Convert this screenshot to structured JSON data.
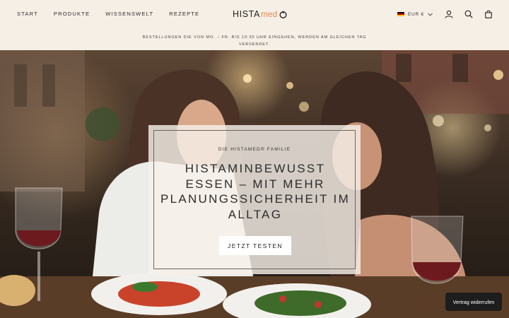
{
  "header": {
    "nav": [
      "START",
      "PRODUKTE",
      "WISSENSWELT",
      "REZEPTE"
    ],
    "logo_main": "HISTA",
    "logo_sub": "med",
    "currency": "EUR €"
  },
  "announcement": {
    "line1": "BESTELLUNGEN DIE VON MO. – FR. BIS 10:30 UHR EINGEHEN, WERDEN AM GLEICHEN TAG",
    "line2": "VERSENDET."
  },
  "hero": {
    "eyebrow": "DIE HISTAMED® FAMILIE",
    "headline": "HISTAMINBEWUSST ESSEN – MIT MEHR PLANUNGSSICHERHEIT IM ALLTAG",
    "cta_label": "JETZT TESTEN"
  },
  "cookie_button": "Vertrag widerrufen",
  "colors": {
    "background": "#f6efe6",
    "text": "#2b2b2b",
    "logo_accent": "#e08a4a",
    "cta_bg": "#ffffff",
    "cookie_bg": "#1d1d1d"
  },
  "icons": [
    "germany-flag-icon",
    "chevron-down-icon",
    "account-icon",
    "search-icon",
    "cart-icon",
    "logo-mark-icon"
  ]
}
